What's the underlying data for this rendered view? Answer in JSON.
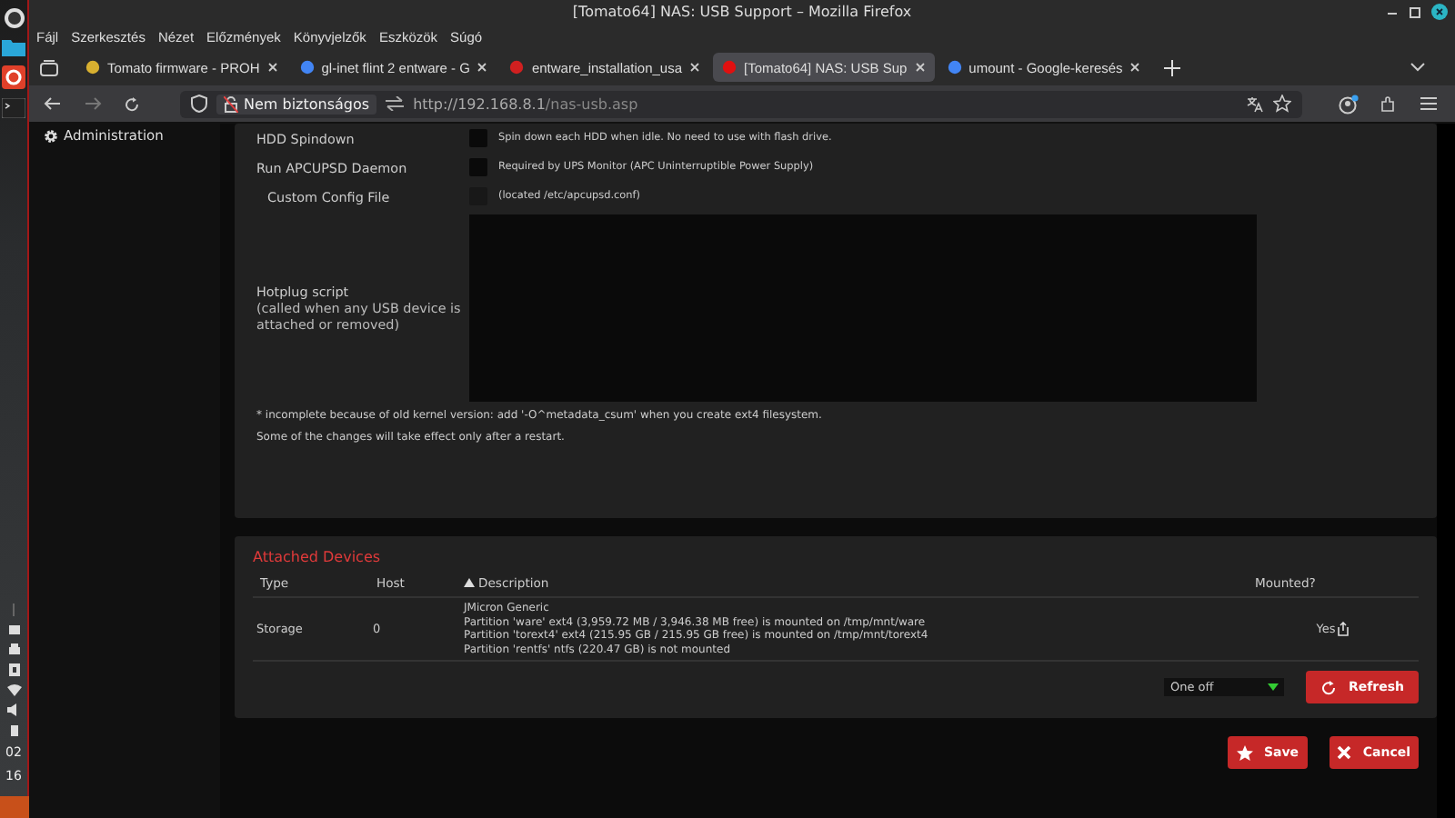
{
  "window": {
    "title": "[Tomato64] NAS: USB Support – Mozilla Firefox"
  },
  "menu": [
    "Fájl",
    "Szerkesztés",
    "Nézet",
    "Előzmények",
    "Könyvjelzők",
    "Eszközök",
    "Súgó"
  ],
  "tabs": [
    {
      "label": "Tomato firmware - PROH",
      "selected": false,
      "color": "#d8b030"
    },
    {
      "label": "gl-inet flint 2 entware - G",
      "selected": false,
      "color": "#4285f4"
    },
    {
      "label": "entware_installation_usa",
      "selected": false,
      "color": "#d02020"
    },
    {
      "label": "[Tomato64] NAS: USB Sup",
      "selected": true,
      "color": "#e01010"
    },
    {
      "label": "umount - Google-keresés",
      "selected": false,
      "color": "#4285f4"
    }
  ],
  "address": {
    "security": "Nem biztonságos",
    "url_host": "http://192.168.8.1",
    "url_path": "/nas-usb.asp"
  },
  "clock": [
    "02",
    "16"
  ],
  "sidebar": {
    "items": [
      {
        "label": "Administration"
      }
    ]
  },
  "settings": [
    {
      "kind": "checkbox",
      "label": "HDD Spindown",
      "checked": false,
      "disabled": false,
      "note": "Spin down each HDD when idle. No need to use with flash drive."
    },
    {
      "kind": "checkbox",
      "label": "Run APCUPSD Daemon",
      "checked": false,
      "disabled": false,
      "note": "Required by UPS Monitor (APC Uninterruptible Power Supply)",
      "children": [
        {
          "kind": "checkbox",
          "label": "Custom Config File",
          "checked": false,
          "disabled": true,
          "note": "(located /etc/apcupsd.conf)"
        }
      ]
    },
    {
      "kind": "textarea",
      "label": "Hotplug script",
      "sublabel": "(called when any USB device is attached or removed)"
    }
  ],
  "notes": [
    "* incomplete because of old kernel version: add '-O^metadata_csum' when you create ext4 filesystem.",
    "Some of the changes will take effect only after a restart."
  ],
  "attached_devices": {
    "title": "Attached Devices",
    "columns": [
      {
        "label": "Type",
        "sorted": false
      },
      {
        "label": "Host",
        "sorted": false
      },
      {
        "label": "Description",
        "sorted": true
      },
      {
        "label": "Mounted?",
        "sorted": false
      }
    ],
    "rows": [
      {
        "type": "Storage",
        "host": "0",
        "description": [
          "JMicron Generic",
          "Partition 'ware' ext4 (3,959.72 MB / 3,946.38 MB free) is mounted on /tmp/mnt/ware",
          "Partition 'torext4' ext4 (215.95 GB / 215.95 GB free) is mounted on /tmp/mnt/torext4",
          "Partition 'rentfs' ntfs (220.47 GB) is not mounted"
        ],
        "mounted": "Yes"
      }
    ],
    "refresh_interval": "One off",
    "refresh_button": "Refresh"
  },
  "buttons": [
    {
      "label": "Save",
      "kind": "save"
    },
    {
      "label": "Cancel",
      "kind": "cancel"
    }
  ]
}
